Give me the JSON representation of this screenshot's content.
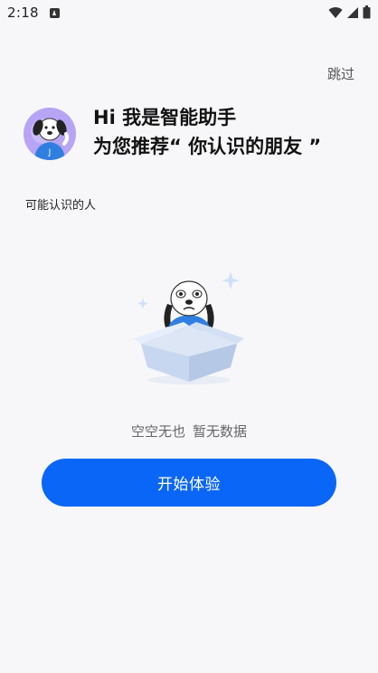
{
  "status_bar": {
    "time": "2:18",
    "icons": [
      "notification-app-icon",
      "wifi-icon",
      "cellular-signal-icon",
      "battery-icon"
    ]
  },
  "header": {
    "skip_label": "跳过"
  },
  "assistant": {
    "avatar_icon": "dog-mascot-avatar-icon",
    "line1": "Hi 我是智能助手",
    "line2": "为您推荐“ 你认识的朋友 ”"
  },
  "section": {
    "title": "可能认识的人"
  },
  "empty_state": {
    "illustration_icon": "dog-in-box-illustration",
    "text_part1": "空空无也",
    "text_part2": "暂无数据"
  },
  "cta": {
    "label": "开始体验",
    "color": "#0a66f6"
  },
  "colors": {
    "background": "#f7f7fa",
    "accent": "#0a66f6"
  }
}
